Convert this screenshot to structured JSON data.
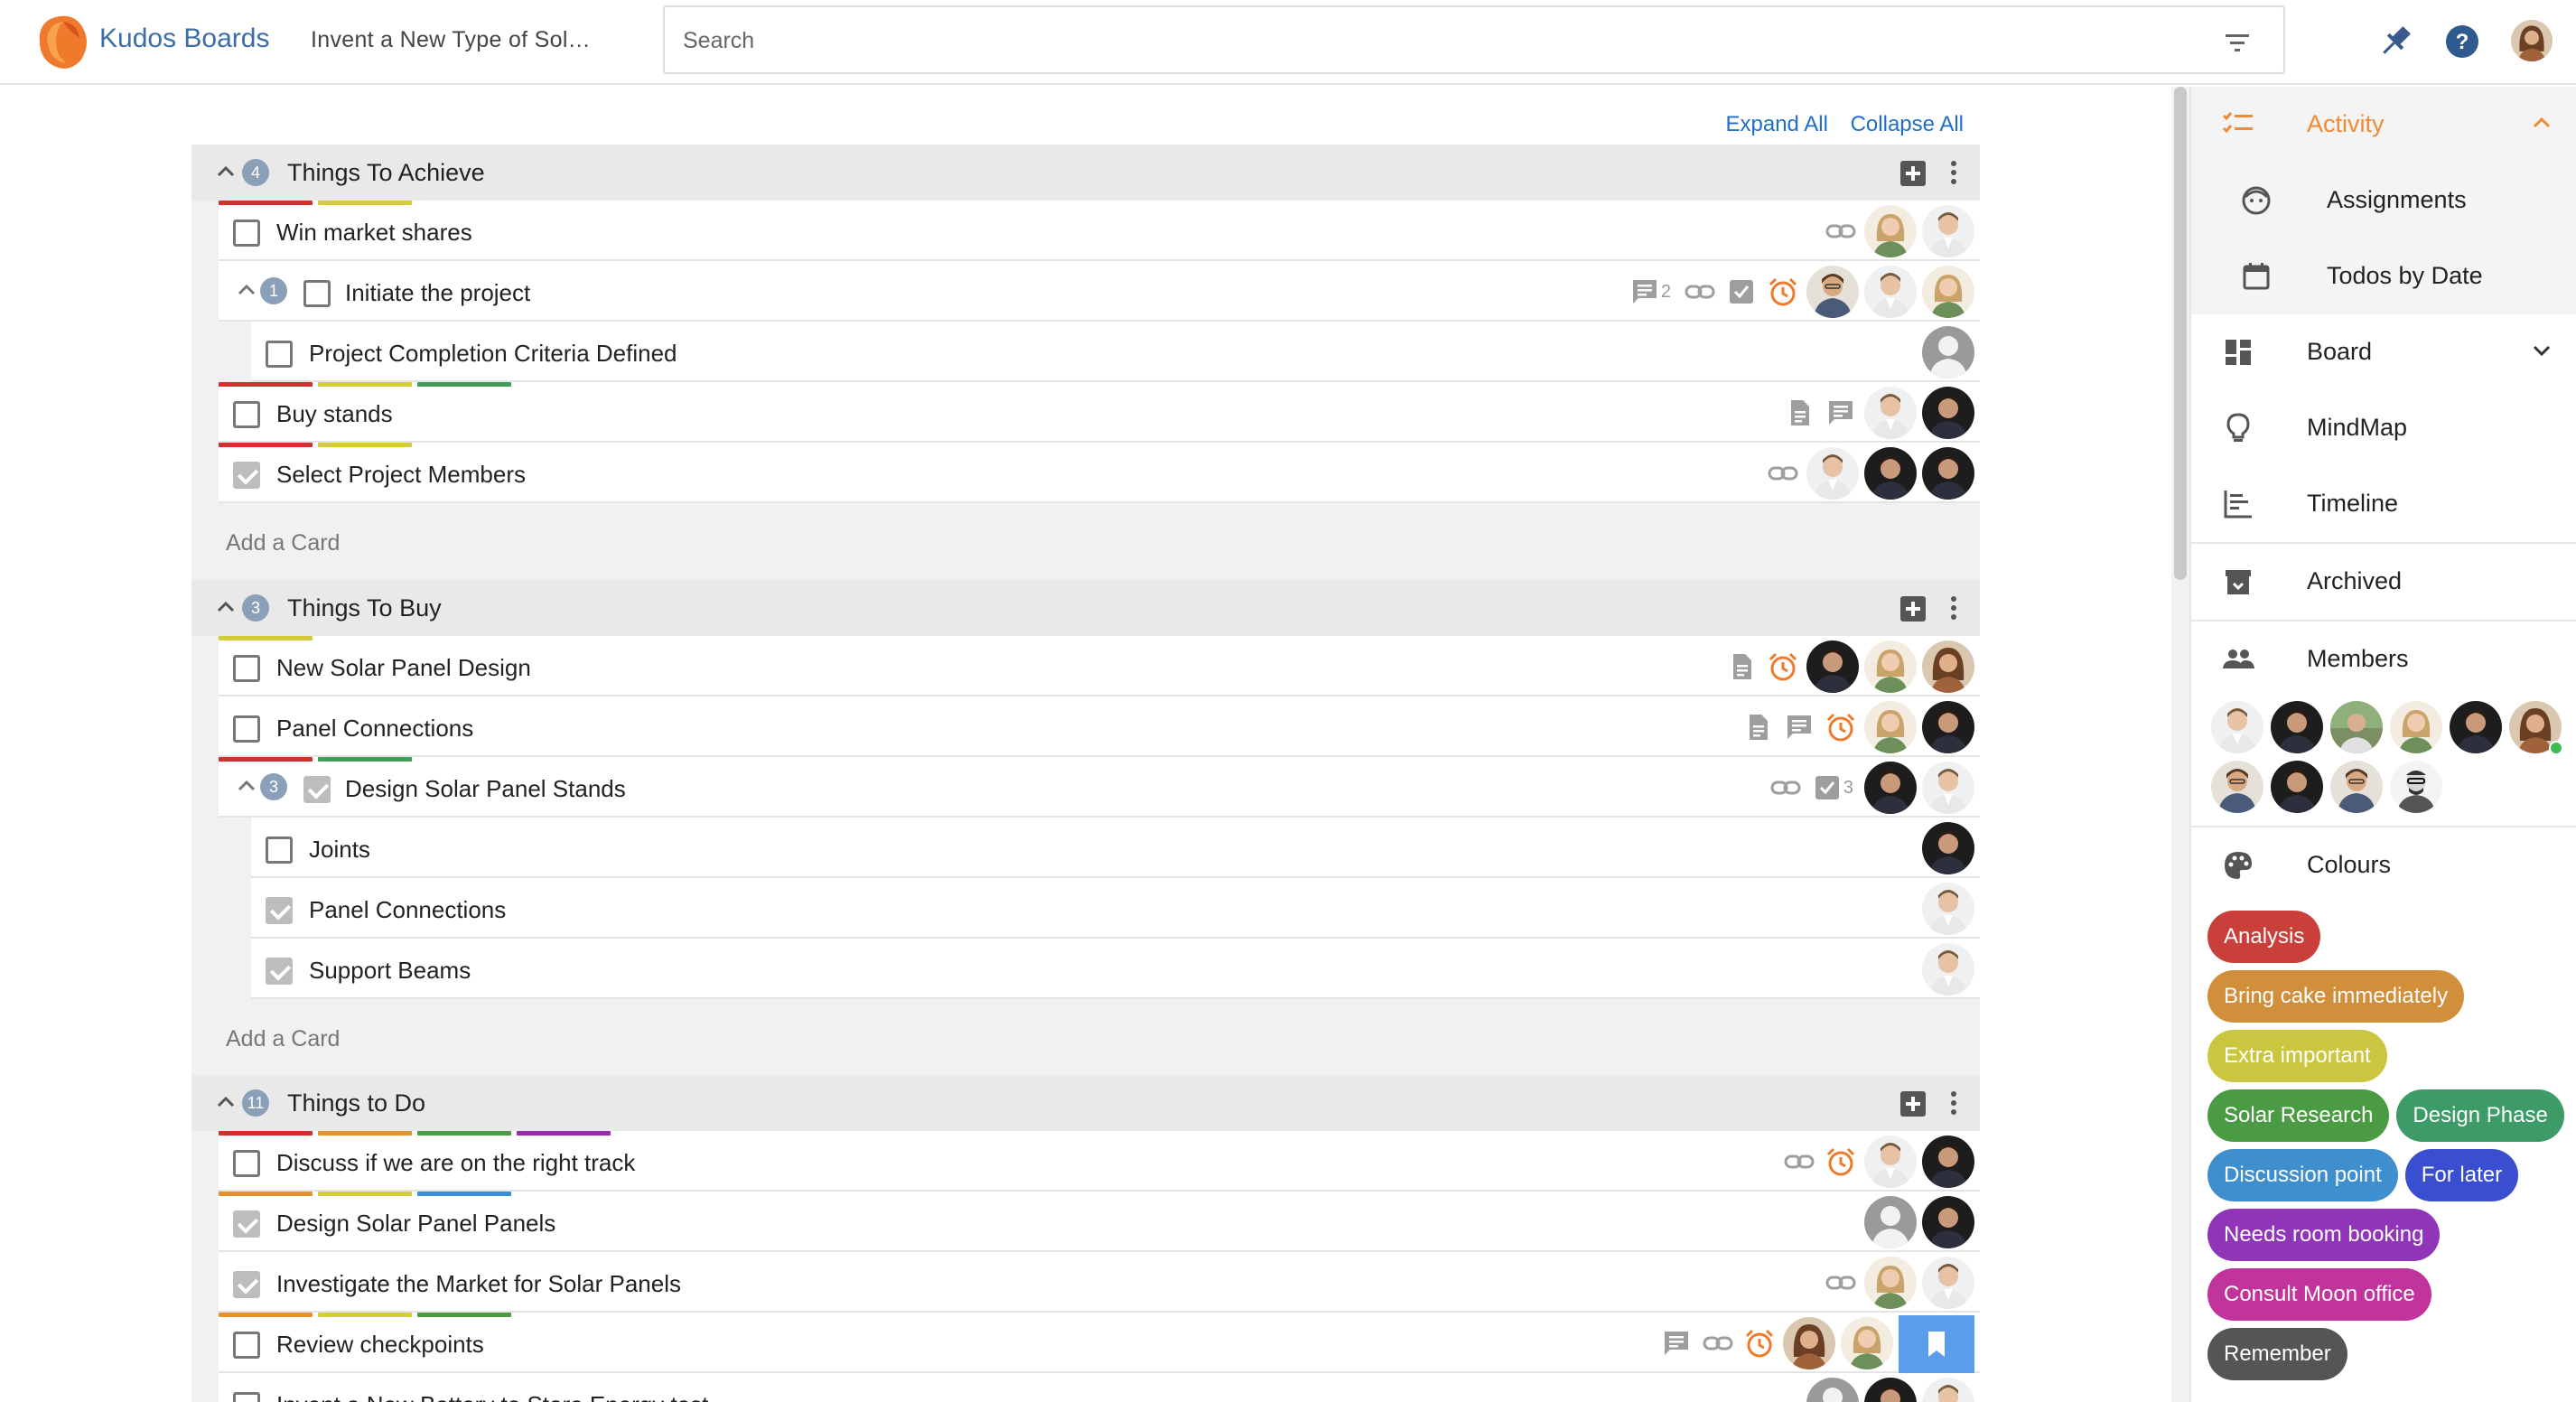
{
  "header": {
    "app_name": "Kudos Boards",
    "board_title": "Invent a New Type of Sol…",
    "search_placeholder": "Search"
  },
  "toolbar": {
    "expand_all": "Expand All",
    "collapse_all": "Collapse All"
  },
  "colors": {
    "red": "#d32f2f",
    "orange": "#e6912e",
    "yellow": "#d4cc3a",
    "green": "#3e9e57",
    "purple": "#9c27b0",
    "blue": "#3a8fd6",
    "accent": "#f08a34",
    "link": "#1f6fc4"
  },
  "groups": [
    {
      "title": "Things To Achieve",
      "count": "4",
      "add_card": "Add a Card",
      "cards": [
        {
          "title": "Win market shares",
          "checked": false,
          "icons": [
            "link-icon"
          ]
        },
        {
          "title": "Initiate the project",
          "checked": false,
          "count": "1",
          "comments": "2",
          "icons": [
            "comment-icon",
            "link-icon",
            "checklist-icon",
            "alarm-icon"
          ]
        },
        {
          "title": "Project Completion Criteria Defined",
          "checked": false,
          "icons": []
        },
        {
          "title": "Buy stands",
          "checked": false,
          "icons": [
            "file-icon",
            "comment-icon"
          ]
        },
        {
          "title": "Select Project Members",
          "checked": true,
          "icons": [
            "link-icon"
          ]
        }
      ]
    },
    {
      "title": "Things To Buy",
      "count": "3",
      "add_card": "Add a Card",
      "cards": [
        {
          "title": "New Solar Panel Design",
          "checked": false,
          "icons": [
            "file-icon",
            "alarm-icon"
          ]
        },
        {
          "title": "Panel Connections",
          "checked": false,
          "icons": [
            "file-icon",
            "comment-icon",
            "alarm-icon"
          ]
        },
        {
          "title": "Design Solar Panel Stands",
          "checked": true,
          "count": "3",
          "checklist_count": "3",
          "icons": [
            "link-icon",
            "checklist-icon"
          ]
        },
        {
          "title": "Joints",
          "checked": false,
          "icons": []
        },
        {
          "title": "Panel Connections",
          "checked": true,
          "icons": []
        },
        {
          "title": "Support Beams",
          "checked": true,
          "icons": []
        }
      ]
    },
    {
      "title": "Things to Do",
      "count": "11",
      "cards": [
        {
          "title": "Discuss if we are on the right track",
          "checked": false,
          "icons": [
            "link-icon",
            "alarm-icon"
          ]
        },
        {
          "title": "Design Solar Panel Panels",
          "checked": true,
          "icons": []
        },
        {
          "title": "Investigate the Market for Solar Panels",
          "checked": true,
          "icons": [
            "link-icon"
          ]
        },
        {
          "title": "Review checkpoints",
          "checked": false,
          "icons": [
            "comment-icon",
            "link-icon",
            "alarm-icon",
            "bookmark-icon"
          ]
        },
        {
          "title": "Invent a New Battery to Store Energy test",
          "checked": false,
          "icons": []
        }
      ]
    }
  ],
  "panel": {
    "activity": "Activity",
    "assignments": "Assignments",
    "todos_by_date": "Todos by Date",
    "board": "Board",
    "mindmap": "MindMap",
    "timeline": "Timeline",
    "archived": "Archived",
    "members": "Members",
    "colours": "Colours",
    "colour_labels": [
      {
        "label": "Analysis",
        "color": "#c9403a"
      },
      {
        "label": "Bring cake immediately",
        "color": "#d18f3c"
      },
      {
        "label": "Extra important",
        "color": "#cbc63f"
      },
      {
        "label": "Solar Research",
        "color": "#4b9b44"
      },
      {
        "label": "Design Phase",
        "color": "#3d9b67"
      },
      {
        "label": "Discussion point",
        "color": "#3f8fce"
      },
      {
        "label": "For later",
        "color": "#3a4fd0"
      },
      {
        "label": "Needs room booking",
        "color": "#9135b8"
      },
      {
        "label": "Consult Moon office",
        "color": "#c0349c"
      },
      {
        "label": "Remember",
        "color": "#555555"
      }
    ]
  }
}
